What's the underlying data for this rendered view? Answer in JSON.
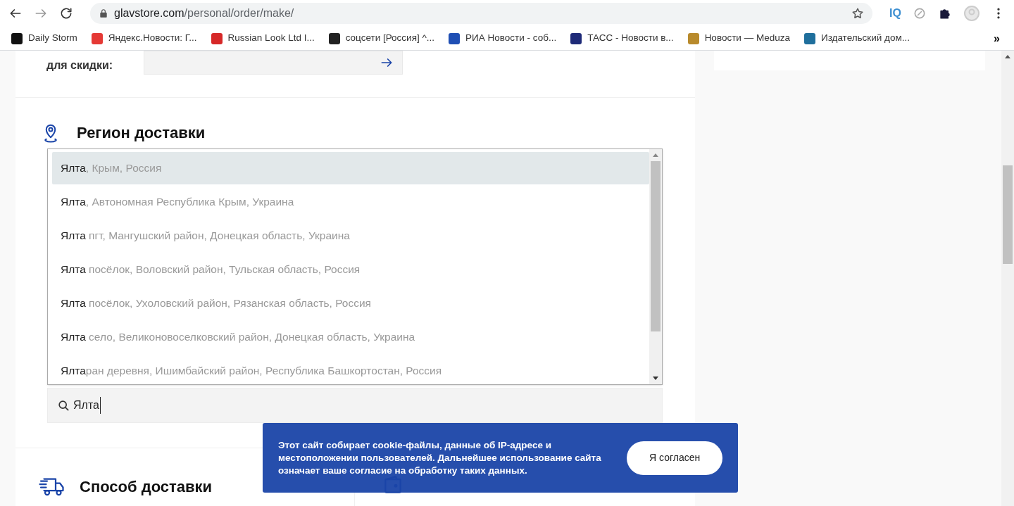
{
  "browser": {
    "url_host": "glavstore.com",
    "url_path": "/personal/order/make/",
    "extension_label": "IQ",
    "bookmarks": [
      {
        "label": "Daily Storm",
        "color": "#111111"
      },
      {
        "label": "Яндекс.Новости: Г...",
        "color": "#e53935"
      },
      {
        "label": "Russian Look Ltd I...",
        "color": "#d62828"
      },
      {
        "label": "соцсети [Россия] ^...",
        "color": "#222222"
      },
      {
        "label": "РИА Новости - соб...",
        "color": "#1f4fb4"
      },
      {
        "label": "ТАСС - Новости в...",
        "color": "#1e2a78"
      },
      {
        "label": "Новости — Meduza",
        "color": "#b88a2c"
      },
      {
        "label": "Издательский дом...",
        "color": "#1f6f9c"
      }
    ],
    "more_label": "»"
  },
  "coupon": {
    "label": "для скидки:"
  },
  "region": {
    "title": "Регион доставки",
    "suggestions": [
      {
        "match": "Ялта",
        "rest": ", Крым, Россия",
        "selected": true
      },
      {
        "match": "Ялта",
        "rest": ", Автономная Республика Крым, Украина",
        "selected": false
      },
      {
        "match": "Ялта",
        "rest": " пгт, Мангушский район, Донецкая область, Украина",
        "selected": false
      },
      {
        "match": "Ялта",
        "rest": " посёлок, Воловский район, Тульская область, Россия",
        "selected": false
      },
      {
        "match": "Ялта",
        "rest": " посёлок, Ухоловский район, Рязанская область, Россия",
        "selected": false
      },
      {
        "match": "Ялта",
        "rest": " село, Великоновоселковский район, Донецкая область, Украина",
        "selected": false
      },
      {
        "match": "Ялта",
        "rest": "ран деревня, Ишимбайский район, Республика Башкортостан, Россия",
        "selected": false
      }
    ],
    "search_value": "Ялта"
  },
  "delivery": {
    "title": "Способ доставки"
  },
  "cookie_banner": {
    "text": "Этот сайт собирает cookie-файлы, данные об IP-адресе и местоположении пользователей. Дальнейшее использование сайта означает ваше согласие на обработку таких данных.",
    "button": "Я согласен"
  }
}
